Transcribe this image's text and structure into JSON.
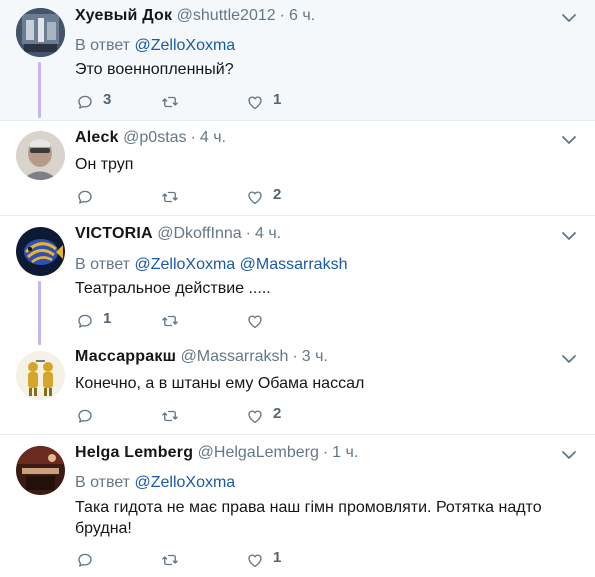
{
  "tweets": [
    {
      "name": "Хуевый Док",
      "handle": "@shuttle2012",
      "time": "6 ч.",
      "reply_prefix": "В ответ",
      "mentions": [
        "@ZelloXoxma"
      ],
      "text": "Это военнопленный?",
      "replies": "3",
      "retweets": "",
      "likes": "1"
    },
    {
      "name": "Aleck",
      "handle": "@p0stas",
      "time": "4 ч.",
      "text": "Он труп",
      "replies": "",
      "retweets": "",
      "likes": "2"
    },
    {
      "name": "VICTORIA",
      "handle": "@DkoffInna",
      "time": "4 ч.",
      "reply_prefix": "В ответ",
      "mentions": [
        "@ZelloXoxma",
        "@Massarraksh"
      ],
      "text": "Театральное действие .....",
      "replies": "1",
      "retweets": "",
      "likes": ""
    },
    {
      "name": "Массарракш",
      "handle": "@Massarraksh",
      "time": "3 ч.",
      "text": "Конечно, а в штаны ему Обама нассал",
      "replies": "",
      "retweets": "",
      "likes": "2"
    },
    {
      "name": "Helga Lemberg",
      "handle": "@HelgaLemberg",
      "time": "1 ч.",
      "reply_prefix": "В ответ",
      "mentions": [
        "@ZelloXoxma"
      ],
      "text_line1": "Така гидота не має права наш гімн промовляти. Ротятка надто",
      "text_line2": "брудна!",
      "replies": "",
      "retweets": "",
      "likes": "1"
    }
  ],
  "separator_dot": "·",
  "colors": {
    "accent_link": "#1b5aa8",
    "secondary_text": "#657786",
    "highlight_bg": "#f5f8fa",
    "thread_line": "#c5b5f0"
  },
  "icons": {
    "reply": "reply-icon",
    "retweet": "retweet-icon",
    "like": "heart-icon",
    "more": "chevron-down-icon"
  }
}
